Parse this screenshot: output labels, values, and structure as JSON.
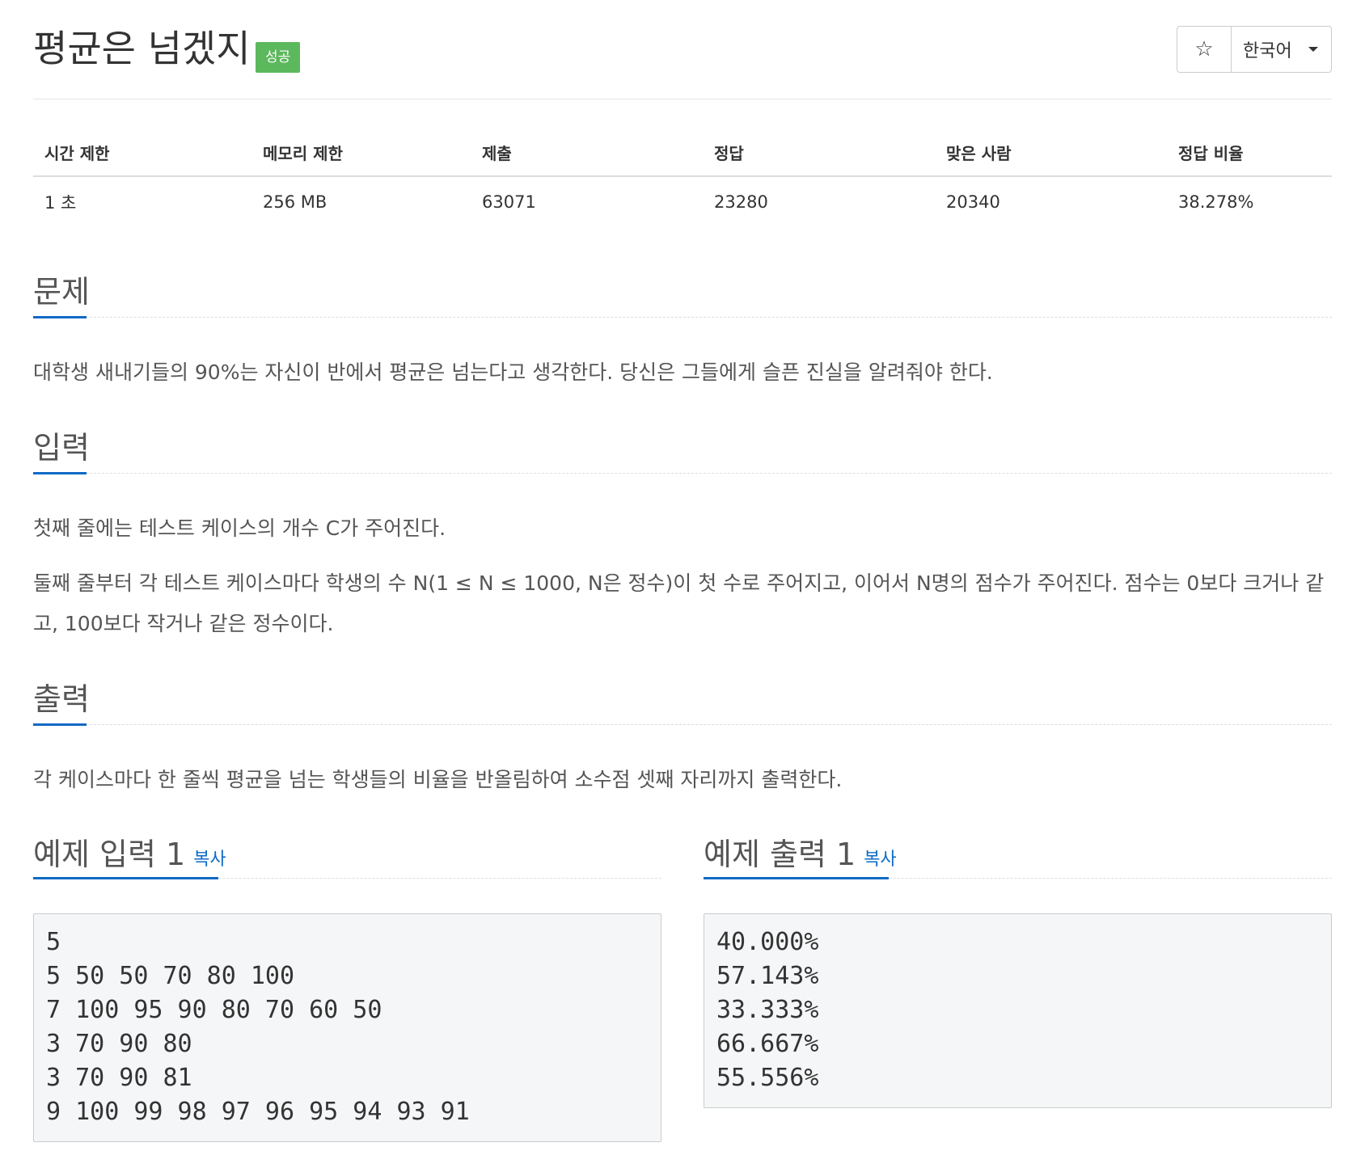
{
  "header": {
    "title": "평균은 넘겠지",
    "badge": "성공",
    "star_icon": "star-icon",
    "star_glyph": "☆",
    "language": "한국어"
  },
  "stats": {
    "headers": [
      "시간 제한",
      "메모리 제한",
      "제출",
      "정답",
      "맞은 사람",
      "정답 비율"
    ],
    "values": [
      "1 초",
      "256 MB",
      "63071",
      "23280",
      "20340",
      "38.278%"
    ]
  },
  "problem": {
    "heading": "문제",
    "text": "대학생 새내기들의 90%는 자신이 반에서 평균은 넘는다고 생각한다. 당신은 그들에게 슬픈 진실을 알려줘야 한다."
  },
  "input": {
    "heading": "입력",
    "paragraphs": [
      "첫째 줄에는 테스트 케이스의 개수 C가 주어진다.",
      "둘째 줄부터 각 테스트 케이스마다 학생의 수 N(1 ≤ N ≤ 1000, N은 정수)이 첫 수로 주어지고, 이어서 N명의 점수가 주어진다. 점수는 0보다 크거나 같고, 100보다 작거나 같은 정수이다."
    ]
  },
  "output": {
    "heading": "출력",
    "text": "각 케이스마다 한 줄씩 평균을 넘는 학생들의 비율을 반올림하여 소수점 셋째 자리까지 출력한다."
  },
  "sample_input": {
    "heading": "예제 입력 1",
    "copy_label": "복사",
    "lines": [
      "5",
      "5 50 50 70 80 100",
      "7 100 95 90 80 70 60 50",
      "3 70 90 80",
      "3 70 90 81",
      "9 100 99 98 97 96 95 94 93 91"
    ]
  },
  "sample_output": {
    "heading": "예제 출력 1",
    "copy_label": "복사",
    "lines": [
      "40.000%",
      "57.143%",
      "33.333%",
      "66.667%",
      "55.556%"
    ]
  },
  "colors": {
    "accent": "#0e6ac5",
    "success_badge": "#5cb85c"
  }
}
